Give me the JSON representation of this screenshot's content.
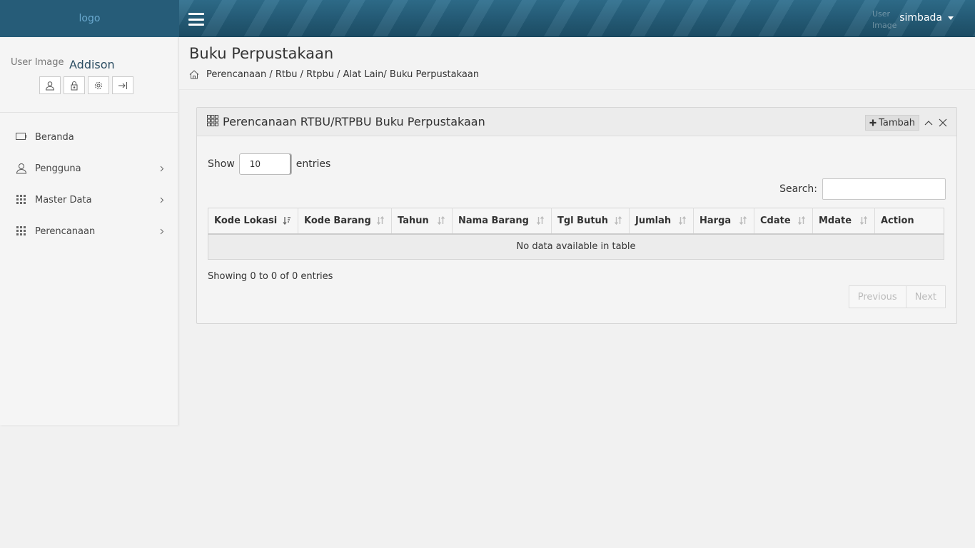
{
  "brand": {
    "logo_text": "logo"
  },
  "topbar": {
    "user_image_alt": "User Image",
    "username": "simbada"
  },
  "sidebar": {
    "user_image_alt": "User Image",
    "user_name": "Addison",
    "profile_buttons": [
      "user-icon",
      "lock-icon",
      "gear-icon",
      "logout-icon"
    ],
    "items": [
      {
        "label": "Beranda",
        "icon": "monitor-icon",
        "has_submenu": false
      },
      {
        "label": "Pengguna",
        "icon": "user-icon",
        "has_submenu": true
      },
      {
        "label": "Master Data",
        "icon": "grid-icon",
        "has_submenu": true
      },
      {
        "label": "Perencanaan",
        "icon": "grid-icon",
        "has_submenu": true
      }
    ]
  },
  "page": {
    "title": "Buku Perpustakaan",
    "breadcrumb": "Perencanaan / Rtbu / Rtpbu /  Alat Lain/ Buku Perpustakaan"
  },
  "panel": {
    "title": "Perencanaan RTBU/RTPBU Buku Perpustakaan",
    "add_button": "Tambah",
    "show_label": "Show",
    "entries_label": "entries",
    "page_length": "10",
    "search_label": "Search:",
    "search_value": "",
    "columns": [
      "Kode Lokasi",
      "Kode Barang",
      "Tahun",
      "Nama Barang",
      "Tgl Butuh",
      "Jumlah",
      "Harga",
      "Cdate",
      "Mdate",
      "Action"
    ],
    "empty_message": "No data available in table",
    "info": "Showing 0 to 0 of 0 entries",
    "prev_label": "Previous",
    "next_label": "Next"
  }
}
